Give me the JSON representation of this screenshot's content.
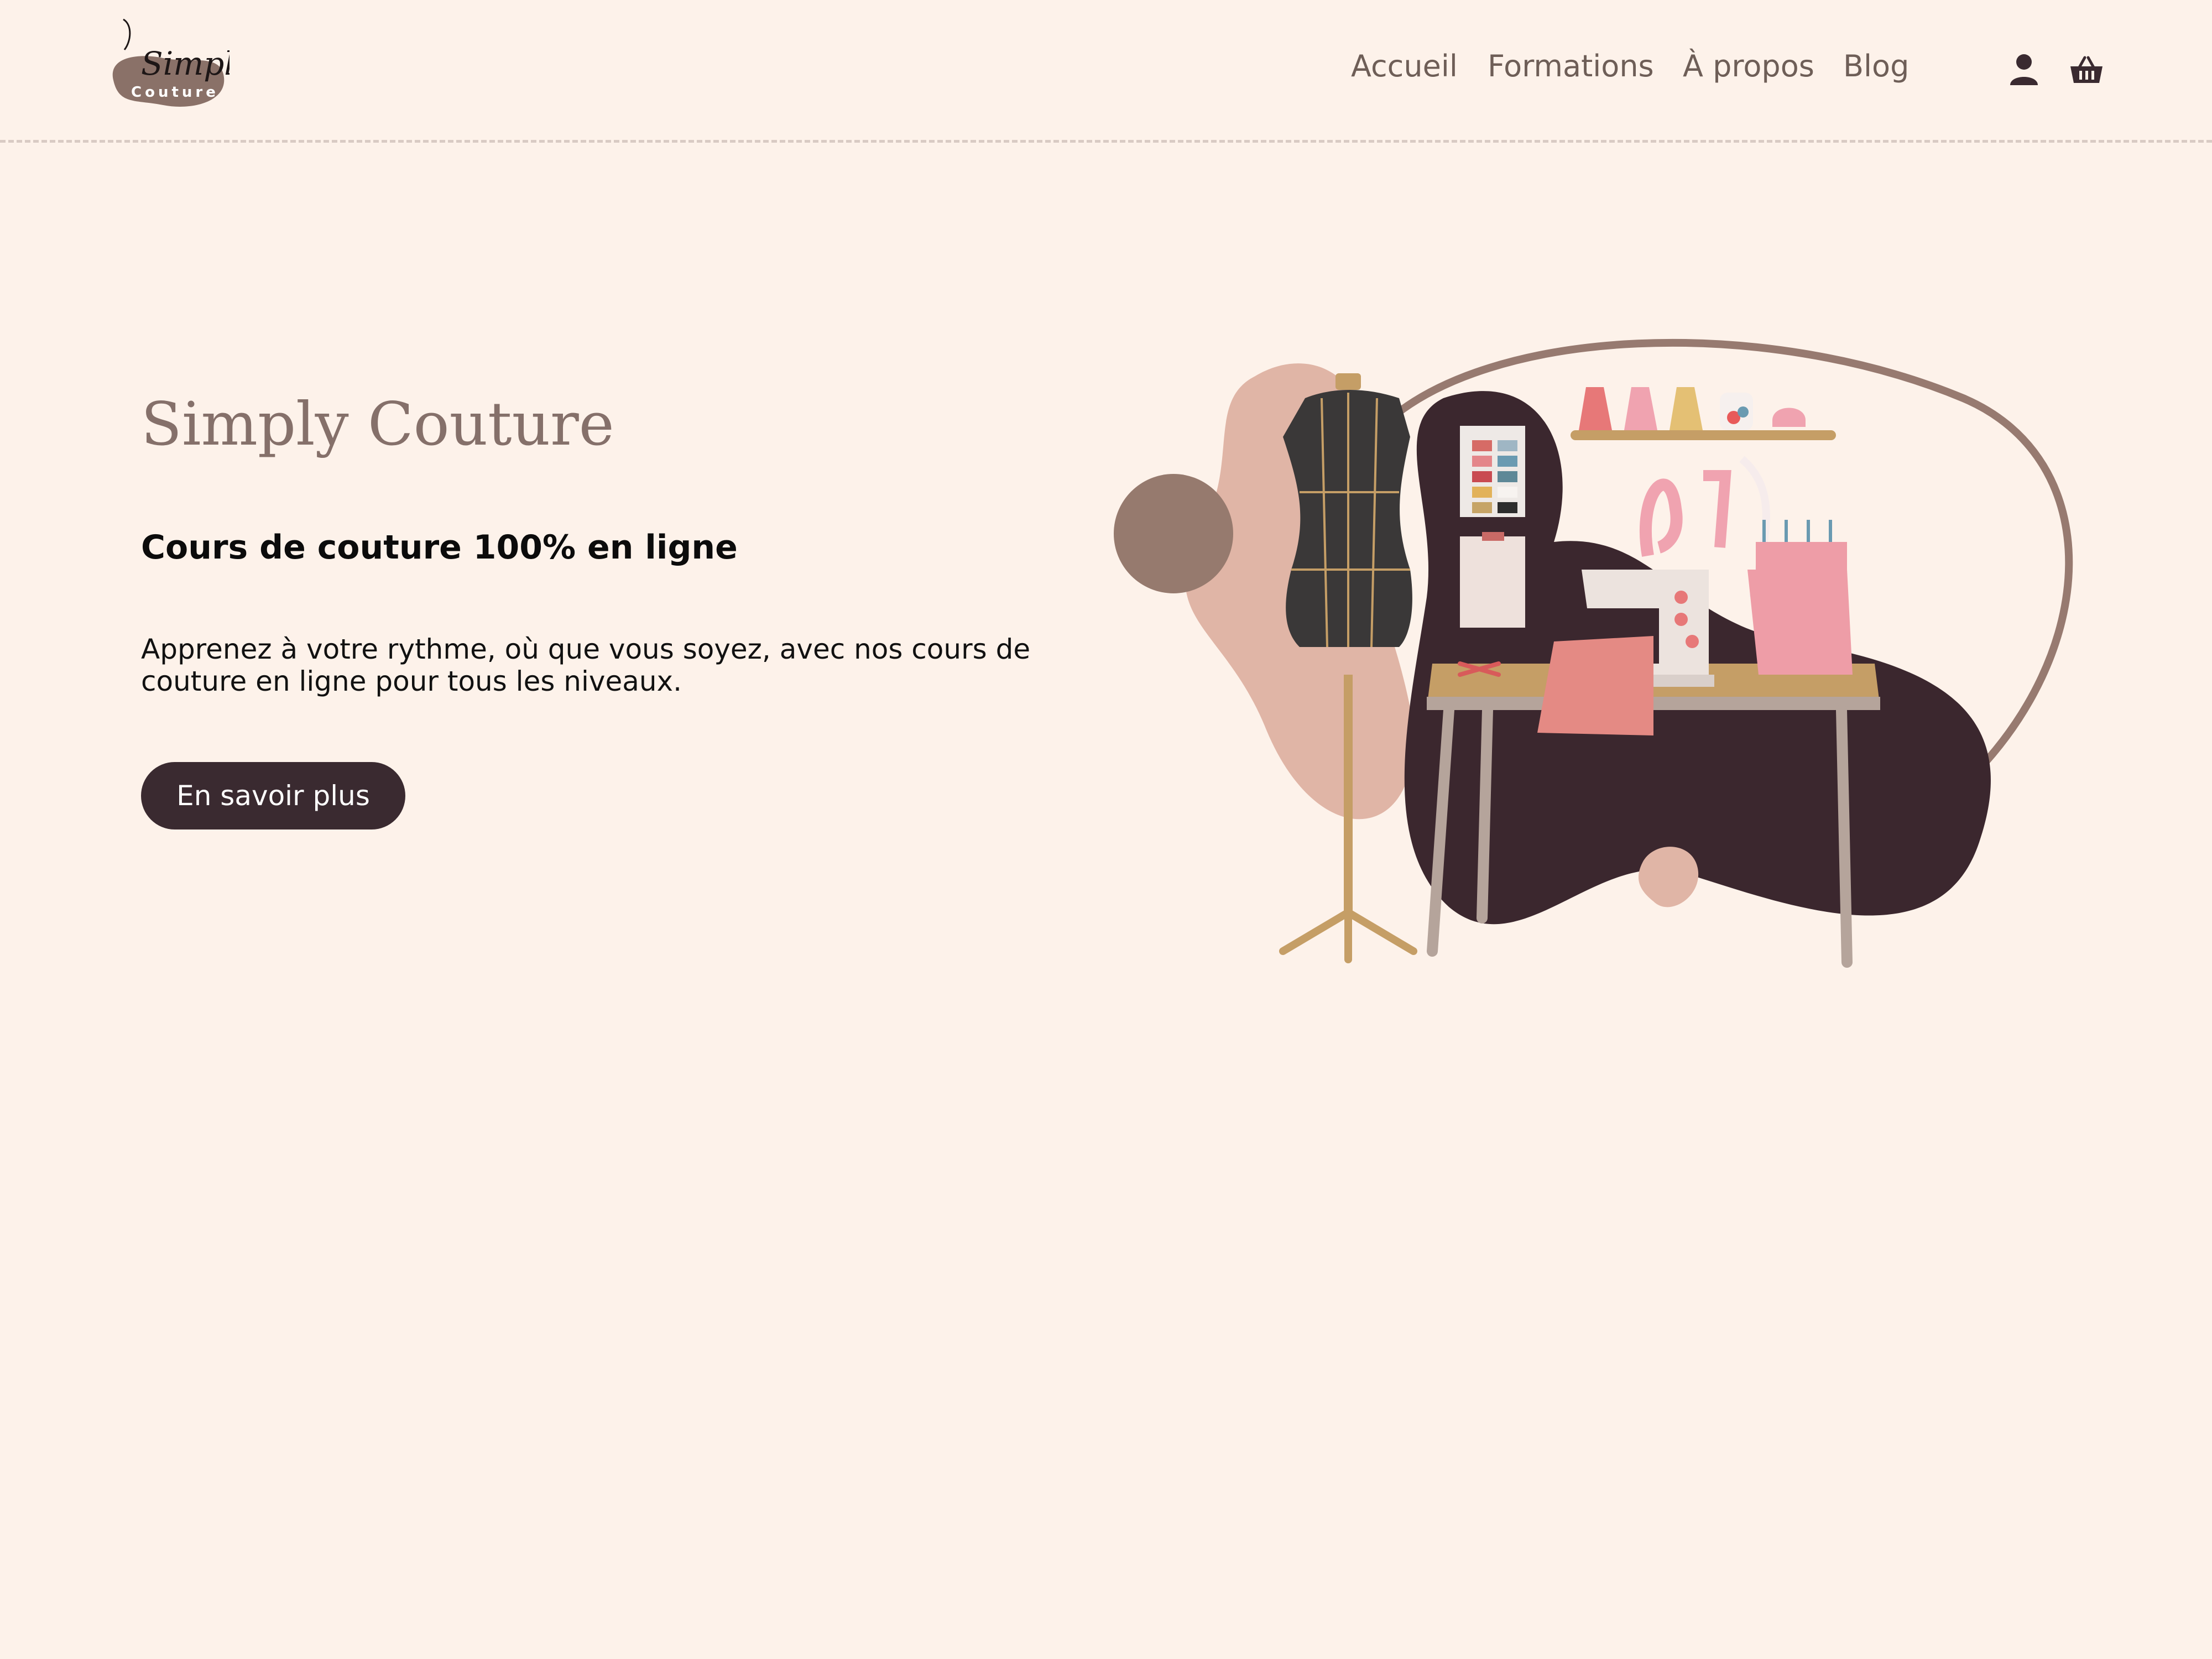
{
  "header": {
    "logo": {
      "script_text": "Simply",
      "sub_text": "Couture"
    },
    "nav": [
      {
        "label": "Accueil"
      },
      {
        "label": "Formations"
      },
      {
        "label": "À propos"
      },
      {
        "label": "Blog"
      }
    ],
    "icons": {
      "account": "user-icon",
      "cart": "basket-icon"
    }
  },
  "hero": {
    "title": "Simply Couture",
    "subtitle": "Cours de couture 100% en ligne",
    "description": "Apprenez à votre rythme, où que vous soyez, avec nos cours de couture en ligne pour tous les niveaux.",
    "cta_label": "En savoir plus"
  },
  "colors": {
    "background": "#fdf2ea",
    "brand_brown": "#85706a",
    "button_dark": "#3a2a30",
    "nav_text": "#6e5e57"
  }
}
